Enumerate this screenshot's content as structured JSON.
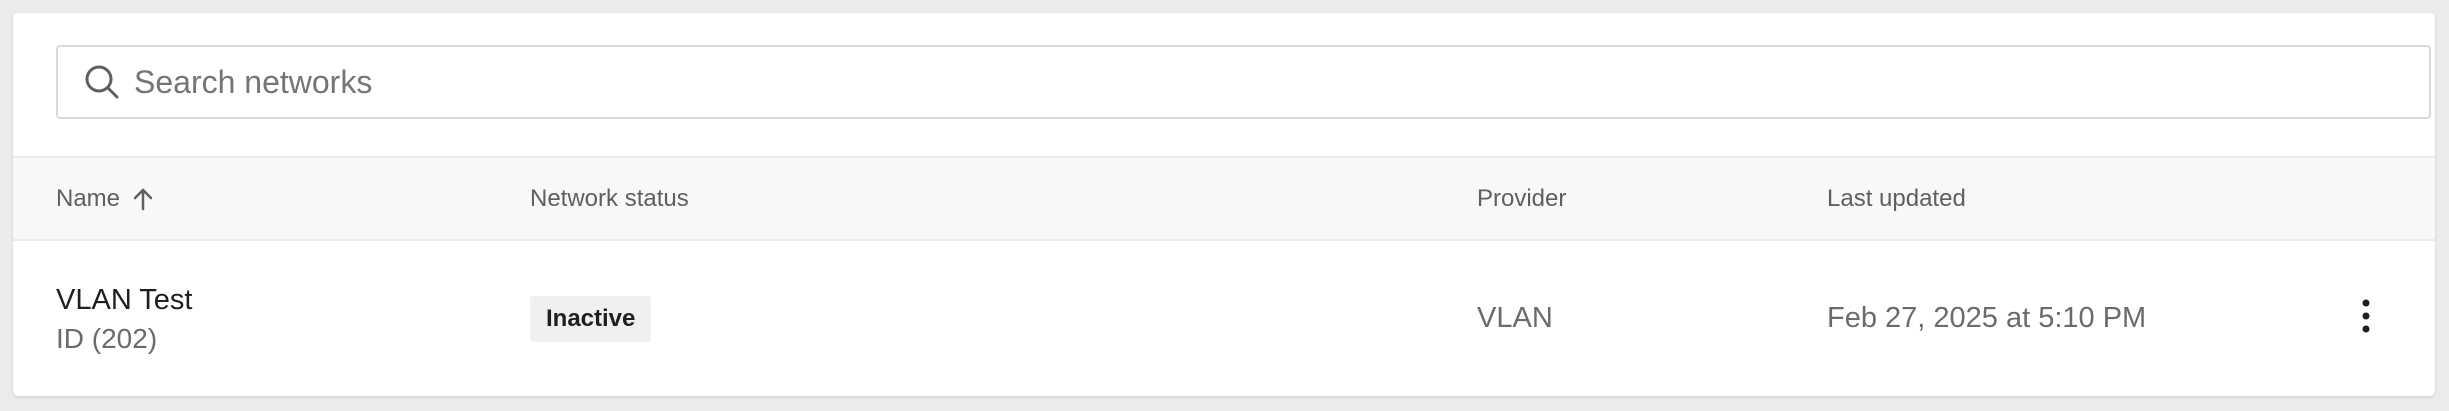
{
  "search": {
    "placeholder": "Search networks",
    "value": ""
  },
  "table": {
    "columns": [
      {
        "label": "Name",
        "sort": "ascending"
      },
      {
        "label": "Network status"
      },
      {
        "label": "Provider"
      },
      {
        "label": "Last updated"
      }
    ],
    "rows": [
      {
        "name": "VLAN Test",
        "id": "ID (202)",
        "status": "Inactive",
        "provider": "VLAN",
        "last_updated": "Feb 27, 2025 at 5:10 PM"
      }
    ]
  },
  "icons": {
    "search": "search-icon",
    "sort": "arrow-up-icon",
    "row_menu": "more-vertical-icon"
  },
  "colors": {
    "background": "#ebebeb",
    "card": "#ffffff",
    "header_bg": "#f8f8f8",
    "badge_bg": "#f0f0f0",
    "muted_text": "#6b6b6b"
  }
}
